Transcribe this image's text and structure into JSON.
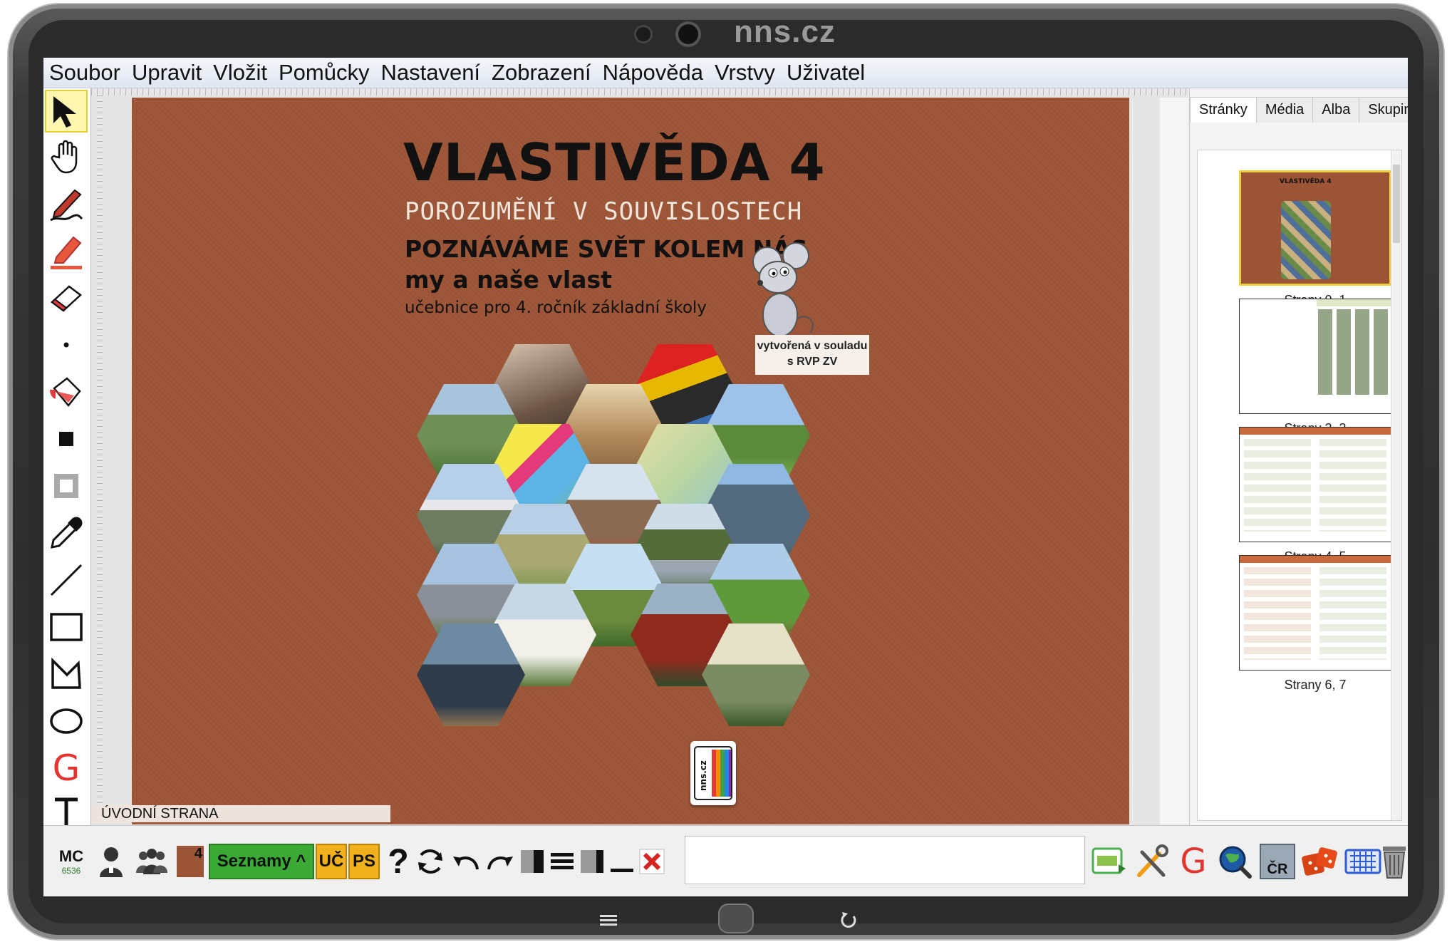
{
  "brand": "nns.cz",
  "menu": [
    "Soubor",
    "Upravit",
    "Vložit",
    "Pomůcky",
    "Nastavení",
    "Zobrazení",
    "Nápověda",
    "Vrstvy",
    "Uživatel"
  ],
  "toolbox": {
    "items": [
      "select-arrow",
      "hand",
      "pen",
      "highlighter",
      "eraser",
      "dot",
      "fill-bucket",
      "filled-square",
      "hollow-square",
      "eyedropper",
      "line",
      "rectangle",
      "polygon",
      "ellipse",
      "g-logo",
      "text"
    ]
  },
  "book": {
    "title": "VLASTIVĚDA 4",
    "subtitle": "POROZUMĚNÍ V SOUVISLOSTECH",
    "heading1": "POZNÁVÁME SVĚT KOLEM NÁS",
    "heading2": "my a naše vlast",
    "heading3": "učebnice pro 4. ročník základní školy",
    "rvp_line1": "vytvořená v souladu",
    "rvp_line2": "s RVP ZV",
    "logo_text": "nns.cz"
  },
  "page_label": "ÚVODNÍ STRANA",
  "side_panel": {
    "tabs": [
      "Stránky",
      "Média",
      "Alba",
      "Skupiny"
    ],
    "active_tab": "Stránky",
    "thumbnails": [
      {
        "label": "Strany 0, 1",
        "selected": true,
        "mini_title": "VLASTIVĚDA 4"
      },
      {
        "label": "Strany 2, 3",
        "selected": false
      },
      {
        "label": "Strany 4, 5",
        "selected": false
      },
      {
        "label": "Strany 6, 7",
        "selected": false
      }
    ]
  },
  "bottombar": {
    "mc_label": "MC",
    "mc_number": "6536",
    "badge_number": "4",
    "seznamy_label": "Seznamy ^",
    "uc_label": "UČ",
    "ps_label": "PS",
    "help_glyph": "?",
    "cr_label": "ČR"
  },
  "colors": {
    "page_bg": "#9c5436",
    "seznamy_bg": "#3aaa35",
    "uc_ps_bg": "#f0b11c",
    "thumb_selected": "#f0d23c",
    "g_red": "#e3342f"
  }
}
